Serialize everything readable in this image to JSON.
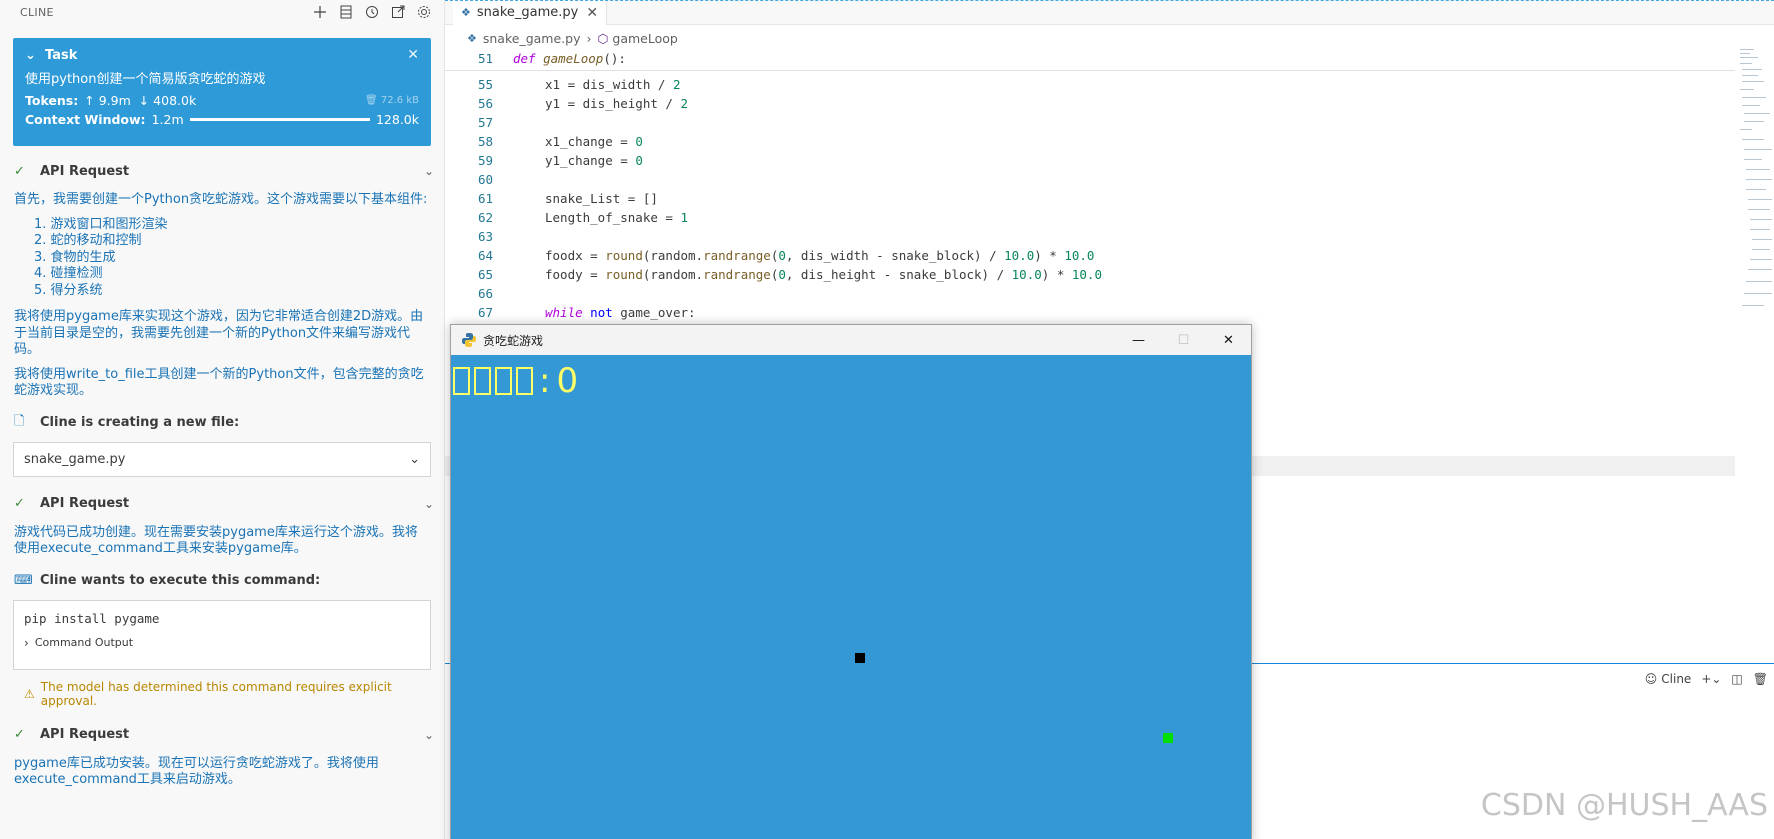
{
  "cline": {
    "header_title": "CLINE",
    "task": {
      "label": "Task",
      "description": "使用python创建一个简易版贪吃蛇的游戏",
      "tokens_label": "Tokens:",
      "tokens_up": "↑ 9.9m",
      "tokens_down": "↓ 408.0k",
      "size": "72.6 kB",
      "context_label": "Context Window:",
      "context_used": "1.2m",
      "context_max": "128.0k"
    },
    "api_request_label": "API Request",
    "msg1": "首先，我需要创建一个Python贪吃蛇游戏。这个游戏需要以下基本组件:",
    "list": [
      "1. 游戏窗口和图形渲染",
      "2. 蛇的移动和控制",
      "3. 食物的生成",
      "4. 碰撞检测",
      "5. 得分系统"
    ],
    "msg2": "我将使用pygame库来实现这个游戏，因为它非常适合创建2D游戏。由于当前目录是空的，我需要先创建一个新的Python文件来编写游戏代码。",
    "msg3": "我将使用write_to_file工具创建一个新的Python文件，包含完整的贪吃蛇游戏实现。",
    "creating_file_label": "Cline is creating a new file:",
    "file_name": "snake_game.py",
    "msg4": "游戏代码已成功创建。现在需要安装pygame库来运行这个游戏。我将使用execute_command工具来安装pygame库。",
    "execute_label": "Cline wants to execute this command:",
    "command": "pip install pygame",
    "command_output": "Command Output",
    "warning": "The model has determined this command requires explicit approval.",
    "msg5": "pygame库已成功安装。现在可以运行贪吃蛇游戏了。我将使用execute_command工具来启动游戏。"
  },
  "editor": {
    "tab_label": "snake_game.py",
    "breadcrumb_file": "snake_game.py",
    "breadcrumb_symbol": "gameLoop",
    "sticky_ln": "51",
    "line_numbers": [
      "55",
      "56",
      "57",
      "58",
      "59",
      "60",
      "61",
      "62",
      "63",
      "64",
      "65",
      "66",
      "67"
    ],
    "terminal_label": "Cline"
  },
  "game": {
    "window_title": "贪吃蛇游戏",
    "score_value": "0"
  },
  "watermark": "CSDN @HUSH_AAS",
  "colors": {
    "task_bg": "#2f9ad8",
    "game_bg": "#3398d4",
    "score": "#ffff66",
    "food": "#00e000"
  }
}
